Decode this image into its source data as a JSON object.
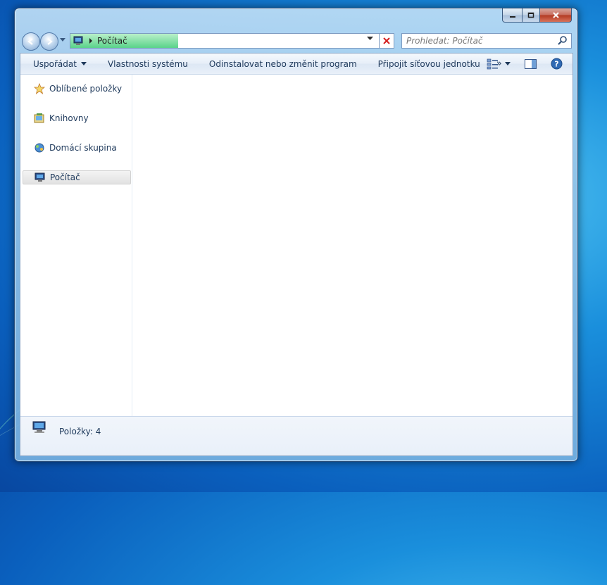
{
  "window": {
    "caption_buttons": {
      "minimize": "minimize",
      "maximize": "maximize",
      "close": "close"
    }
  },
  "nav": {
    "address_text": "Počítač",
    "address_progress": 0.35,
    "search_placeholder": "Prohledat: Počítač"
  },
  "toolbar": {
    "items": [
      "Uspořádat",
      "Vlastnosti systému",
      "Odinstalovat nebo změnit program",
      "Připojit síťovou jednotku"
    ],
    "more": "»"
  },
  "sidebar": {
    "items": [
      {
        "label": "Oblíbené položky",
        "icon": "star-icon"
      },
      {
        "label": "Knihovny",
        "icon": "libraries-icon"
      },
      {
        "label": "Domácí skupina",
        "icon": "homegroup-icon"
      },
      {
        "label": "Počítač",
        "icon": "computer-icon",
        "selected": true
      }
    ]
  },
  "status": {
    "items_text": "Položky: 4"
  },
  "colors": {
    "accent": "#1e395b",
    "progress": "#5ad38a",
    "close": "#b23a22"
  }
}
